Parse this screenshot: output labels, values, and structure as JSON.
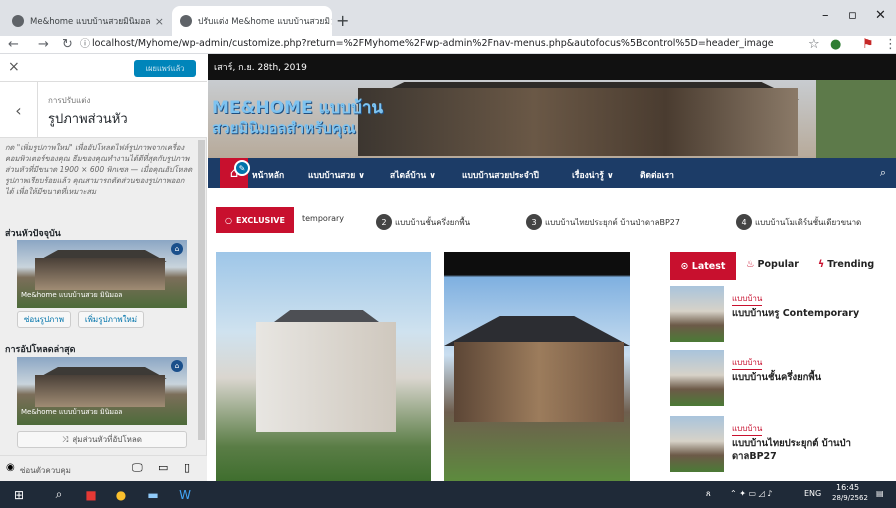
{
  "browser": {
    "tabs": [
      {
        "title": "Me&home แบบบ้านสวยมินิมอล"
      },
      {
        "title": "ปรับแต่ง Me&home แบบบ้านสวยมิ"
      }
    ],
    "new_tab": "+",
    "url": "localhost/Myhome/wp-admin/customize.php?return=%2FMyhome%2Fwp-admin%2Fnav-menus.php&autofocus%5Bcontrol%5D=header_image"
  },
  "customizer": {
    "close": "×",
    "publish_label": "เผยแพร่แล้ว",
    "breadcrumb": "การปรับแต่ง",
    "section_title": "รูปภาพส่วนหัว",
    "description": "กด \"เพิ่มรูปภาพใหม่\" เพื่ออัปโหลดไฟล์รูปภาพจากเครื่องคอมพิวเตอร์ของคุณ ธีมของคุณทำงานได้ดีที่สุดกับรูปภาพส่วนหัวที่มีขนาด 1900 × 600 พิกเซล — เมื่อคุณอัปโหลดรูปภาพเรียบร้อยแล้ว คุณสามารถตัดส่วนของรูปภาพออกได้ เพื่อให้มีขนาดที่เหมาะสม",
    "current_label": "ส่วนหัวปัจจุบัน",
    "thumb_text": "Me&home แบบบ้านสวย มินิมอล",
    "hide_button": "ซ่อนรูปภาพ",
    "add_button": "เพิ่มรูปภาพใหม่",
    "recent_label": "การอัปโหลดล่าสุด",
    "randomize_button": "สุ่มส่วนหัวที่อัปโหลด",
    "hide_controls": "ซ่อนตัวควบคุม"
  },
  "site": {
    "date": "เสาร์, ก.ย. 28th, 2019",
    "logo_line1": "ME&HOME แบบบ้าน",
    "logo_line2": "สวยมินิมอลสำหรับคุณ",
    "nav": [
      "หน้าหลัก",
      "แบบบ้านสวย ∨",
      "สไตล์บ้าน ∨",
      "แบบบ้านสวยประจำปี",
      "เรื่องน่ารู้ ∨",
      "ติดต่อเรา"
    ],
    "exclusive": "EXCLUSIVE",
    "ticker": [
      {
        "num": "",
        "text": "temporary"
      },
      {
        "num": "2",
        "text": "แบบบ้านชั้นครึ่งยกพื้น"
      },
      {
        "num": "3",
        "text": "แบบบ้านไทยประยุกต์ บ้านป่าดาลBP27"
      },
      {
        "num": "4",
        "text": "แบบบ้านโมเดิร์นชั้นเดียวขนาด"
      }
    ],
    "sidebar_tabs": {
      "latest": "⊙ Latest",
      "popular": "Popular",
      "trending": "Trending"
    },
    "posts": [
      {
        "category": "แบบบ้าน",
        "title": "แบบบ้านหรู Contemporary"
      },
      {
        "category": "แบบบ้าน",
        "title": "แบบบ้านชั้นครึ่งยกพื้น"
      },
      {
        "category": "แบบบ้าน",
        "title": "แบบบ้านไทยประยุกต์ บ้านป่าดาลBP27"
      }
    ]
  },
  "taskbar": {
    "lang": "ENG",
    "time": "16:45",
    "date": "28/9/2562"
  }
}
